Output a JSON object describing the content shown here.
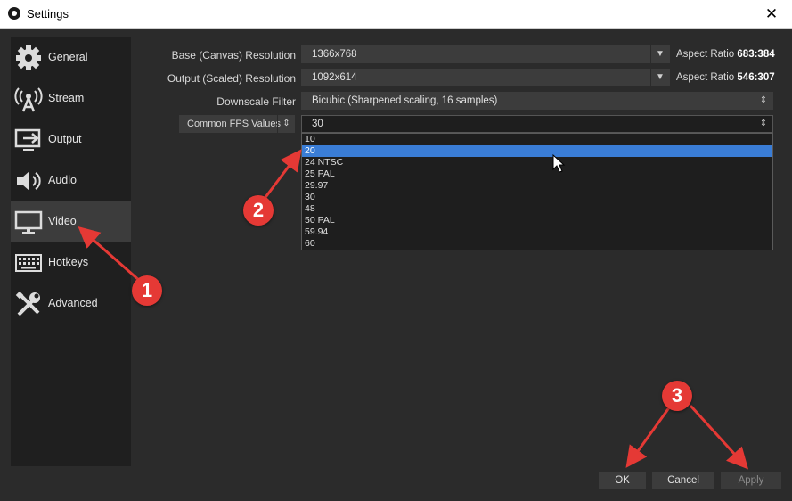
{
  "window": {
    "title": "Settings",
    "close_glyph": "✕"
  },
  "sidebar": {
    "items": [
      {
        "label": "General",
        "icon": "gear-icon"
      },
      {
        "label": "Stream",
        "icon": "broadcast-icon"
      },
      {
        "label": "Output",
        "icon": "output-icon"
      },
      {
        "label": "Audio",
        "icon": "speaker-icon"
      },
      {
        "label": "Video",
        "icon": "monitor-icon",
        "active": true
      },
      {
        "label": "Hotkeys",
        "icon": "keyboard-icon"
      },
      {
        "label": "Advanced",
        "icon": "tools-icon"
      }
    ]
  },
  "video": {
    "base_label": "Base (Canvas) Resolution",
    "base_value": "1366x768",
    "base_aspect_prefix": "Aspect Ratio ",
    "base_aspect_value": "683:384",
    "output_label": "Output (Scaled) Resolution",
    "output_value": "1092x614",
    "output_aspect_prefix": "Aspect Ratio ",
    "output_aspect_value": "546:307",
    "filter_label": "Downscale Filter",
    "filter_value": "Bicubic (Sharpened scaling, 16 samples)",
    "fps_type": "Common FPS Values",
    "fps_value": "30",
    "fps_options": [
      "10",
      "20",
      "24 NTSC",
      "25 PAL",
      "29.97",
      "30",
      "48",
      "50 PAL",
      "59.94",
      "60"
    ],
    "fps_highlighted": "20"
  },
  "buttons": {
    "ok": "OK",
    "cancel": "Cancel",
    "apply": "Apply"
  },
  "annotations": {
    "badge1": "1",
    "badge2": "2",
    "badge3": "3",
    "color": "#e53935"
  }
}
